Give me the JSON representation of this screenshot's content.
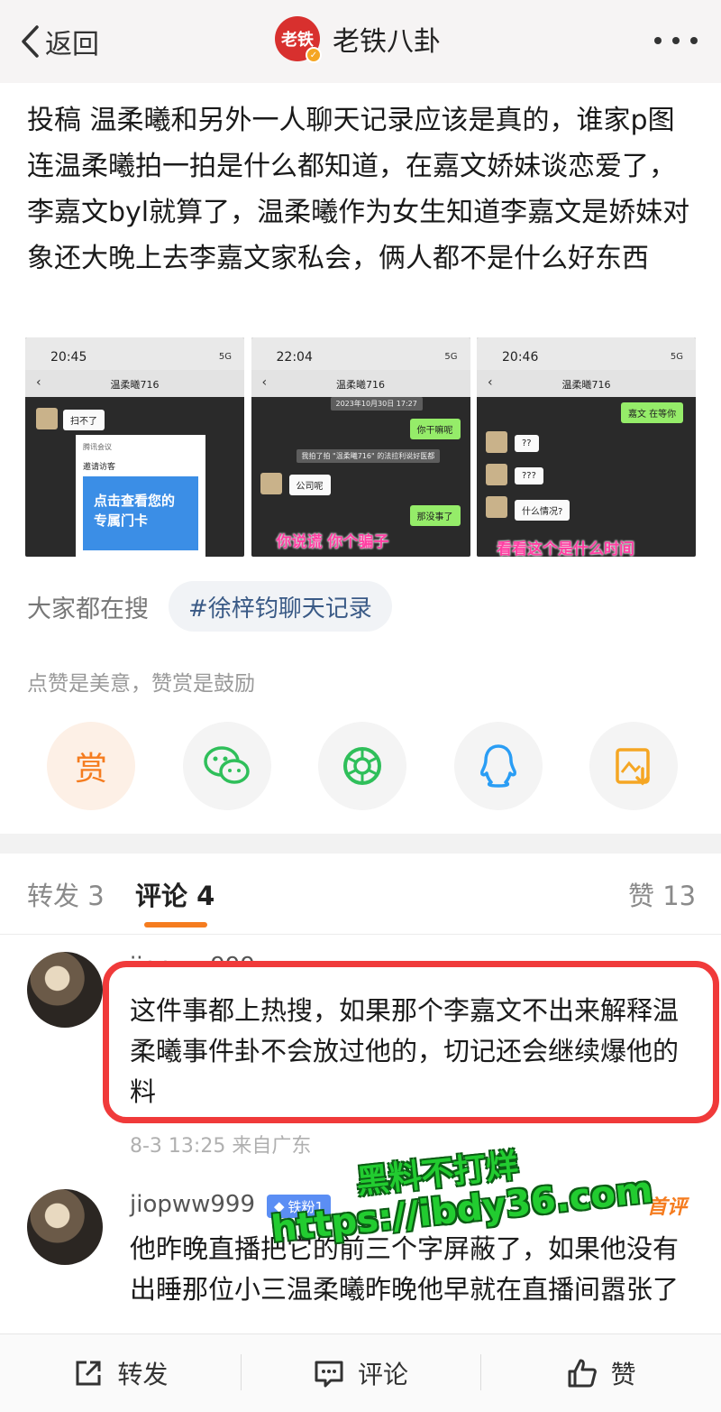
{
  "topbar": {
    "back_label": "返回",
    "account_avatar_text": "老铁",
    "account_name": "老铁八卦"
  },
  "post": {
    "text": "投稿 温柔曦和另外一人聊天记录应该是真的，谁家p图连温柔曦拍一拍是什么都知道，在嘉文娇妹谈恋爱了，李嘉文byl就算了，温柔曦作为女生知道李嘉文是娇妹对象还大晚上去李嘉文家私会，俩人都不是什么好东西",
    "images": [
      {
        "time": "20:45",
        "signal": "5G",
        "contact": "温柔曦716",
        "messages": [
          "扫不了"
        ],
        "card_head": "腾讯会议",
        "card_sub": "邀请访客",
        "card_body": "点击查看您的专属门卡"
      },
      {
        "time": "22:04",
        "signal": "5G",
        "contact": "温柔曦716",
        "date_stamp": "2023年10月30日 17:27",
        "system_note": "我拍了拍 \"温柔曦716\" 的法拉利说好医都",
        "messages": [
          "你干嘛呢",
          "公司呢",
          "那没事了"
        ],
        "overlay": "你说谎 你个骗子"
      },
      {
        "time": "20:46",
        "signal": "5G",
        "contact": "温柔曦716",
        "messages": [
          "嘉文 在等你",
          "??",
          "???",
          "什么情况?"
        ],
        "overlay": "看看这个是什么时间"
      }
    ]
  },
  "search": {
    "label": "大家都在搜",
    "tag": "#徐梓钧聊天记录"
  },
  "reward": {
    "caption": "点赞是美意，赞赏是鼓励",
    "reward_label": "赏"
  },
  "tabs": {
    "repost": "转发 3",
    "comments": "评论 4",
    "likes": "赞 13"
  },
  "comments": [
    {
      "user": "jiopww999",
      "text": "这件事都上热搜，如果那个李嘉文不出来解释温柔曦事件卦不会放过他的，切记还会继续爆他的料",
      "meta": "8-3 13:25 来自广东"
    },
    {
      "user": "jiopww999",
      "badge": "铁粉1",
      "tag": "首评",
      "text": "他昨晚直播把它的前三个字屏蔽了，如果他没有出睡那位小三温柔曦昨晚他早就在直播间嚣张了"
    }
  ],
  "watermark": {
    "line1": "黑料不打烊",
    "line2": "https://ibdy36.com"
  },
  "bottom": {
    "repost": "转发",
    "comment": "评论",
    "like": "赞"
  },
  "colors": {
    "accent": "#f57c1f",
    "highlight_box": "#f03a3a",
    "tag_text": "#3a5a86"
  }
}
